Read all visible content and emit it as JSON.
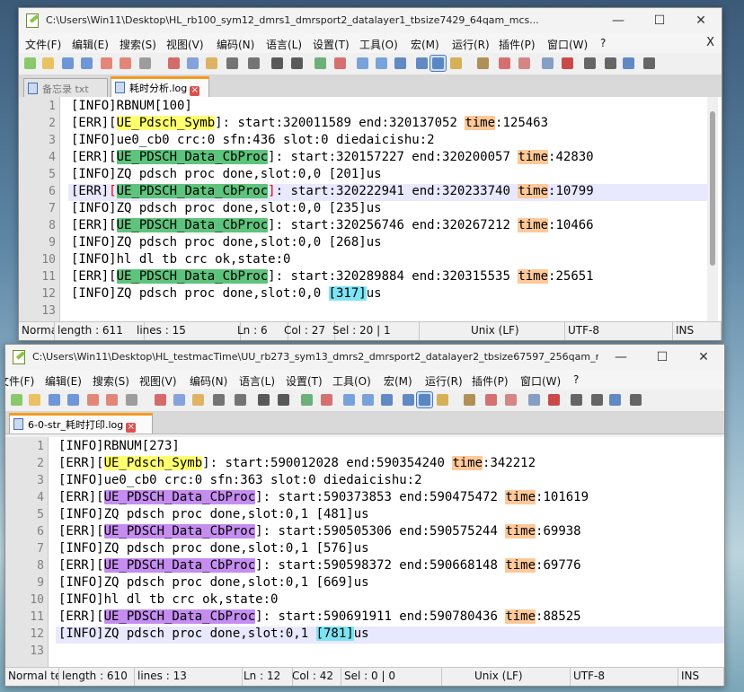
{
  "menu": [
    "文件(F)",
    "编辑(E)",
    "搜索(S)",
    "视图(V)",
    "编码(N)",
    "语言(L)",
    "设置(T)",
    "工具(O)",
    "宏(M)",
    "运行(R)",
    "插件(P)",
    "窗口(W)",
    "?"
  ],
  "window_controls": {
    "minimize": "—",
    "maximize": "☐",
    "close": "✕"
  },
  "menu_close": "X",
  "toolbar_icons": [
    "new-file-icon",
    "open-file-icon",
    "save-icon",
    "save-all-icon",
    "close-icon",
    "close-all-icon",
    "print-icon",
    "cut-icon",
    "copy-icon",
    "paste-icon",
    "undo-icon",
    "redo-icon",
    "find-icon",
    "replace-icon",
    "zoom-in-icon",
    "zoom-out-icon",
    "sync-vertical-icon",
    "sync-horizontal-icon",
    "word-wrap-icon",
    "show-all-chars-icon",
    "indent-guide-icon",
    "udl-icon",
    "doc-map-icon",
    "function-list-icon",
    "folder-workspace-icon",
    "monitor-icon",
    "record-macro-icon",
    "stop-macro-icon",
    "play-macro-icon",
    "run-macro-multiple-icon",
    "save-macro-icon"
  ],
  "windows": [
    {
      "title": "C:\\Users\\Win11\\Desktop\\HL_rb100_sym12_dmrs1_dmrsport2_datalayer1_tbsize7429_64qam_mcs...",
      "tabs": [
        {
          "label": "备忘录 txt",
          "active": false
        },
        {
          "label": "耗时分析.log",
          "active": true
        }
      ],
      "lines": [
        {
          "n": "1",
          "parts": [
            {
              "t": "[INFO]RBNUM[100]"
            }
          ]
        },
        {
          "n": "2",
          "parts": [
            {
              "t": "[ERR]["
            },
            {
              "t": "UE_Pdsch_Symb",
              "c": "yellow"
            },
            {
              "t": "]: start:320011589 end:320137052 "
            },
            {
              "t": "time",
              "c": "orange"
            },
            {
              "t": ":125463"
            }
          ]
        },
        {
          "n": "3",
          "parts": [
            {
              "t": "[INFO]ue0_cb0 crc:0 sfn:436 slot:0 diedaicishu:2"
            }
          ]
        },
        {
          "n": "4",
          "parts": [
            {
              "t": "[ERR]["
            },
            {
              "t": "UE_PDSCH_Data_CbProc",
              "c": "green"
            },
            {
              "t": "]: start:320157227 end:320200057 "
            },
            {
              "t": "time",
              "c": "orange"
            },
            {
              "t": ":42830"
            }
          ]
        },
        {
          "n": "5",
          "parts": [
            {
              "t": "[INFO]ZQ pdsch proc done,slot:0,0 [201]us"
            }
          ]
        },
        {
          "n": "6",
          "current": true,
          "parts": [
            {
              "t": "[ERR]"
            },
            {
              "t": "[",
              "c": "red"
            },
            {
              "t": "UE_PDSCH_Data_CbProc",
              "c": "green"
            },
            {
              "t": "]",
              "c": "red"
            },
            {
              "t": ": start:320222941 end:320233740 "
            },
            {
              "t": "time",
              "c": "orange"
            },
            {
              "t": ":10799"
            }
          ]
        },
        {
          "n": "7",
          "parts": [
            {
              "t": "[INFO]ZQ pdsch proc done,slot:0,0 [235]us"
            }
          ]
        },
        {
          "n": "8",
          "parts": [
            {
              "t": "[ERR]["
            },
            {
              "t": "UE_PDSCH_Data_CbProc",
              "c": "green"
            },
            {
              "t": "]: start:320256746 end:320267212 "
            },
            {
              "t": "time",
              "c": "orange"
            },
            {
              "t": ":10466"
            }
          ]
        },
        {
          "n": "9",
          "parts": [
            {
              "t": "[INFO]ZQ pdsch proc done,slot:0,0 [268]us"
            }
          ]
        },
        {
          "n": "10",
          "parts": [
            {
              "t": "[INFO]hl dl tb crc ok,state:0"
            }
          ]
        },
        {
          "n": "11",
          "parts": [
            {
              "t": "[ERR]["
            },
            {
              "t": "UE_PDSCH_Data_CbProc",
              "c": "green"
            },
            {
              "t": "]: start:320289884 end:320315535 "
            },
            {
              "t": "time",
              "c": "orange"
            },
            {
              "t": ":25651"
            }
          ]
        },
        {
          "n": "12",
          "parts": [
            {
              "t": "[INFO]ZQ pdsch proc done,slot:0,0 "
            },
            {
              "t": "[317]",
              "c": "cyan"
            },
            {
              "t": "us"
            }
          ]
        },
        {
          "n": "13",
          "parts": [
            {
              "t": ""
            }
          ]
        }
      ],
      "status": [
        "Norma",
        "length : 611",
        "lines : 15",
        "Ln : 6",
        "Col : 27",
        "Sel : 20 | 1",
        "Unix (LF)",
        "UTF-8",
        "INS"
      ]
    },
    {
      "title": "C:\\Users\\Win11\\Desktop\\HL_testmacTime\\UU_rb273_sym13_dmrs2_dmrsport2_datalayer2_tbsize67597_256qam_mcs...",
      "tabs": [
        {
          "label": "6-0-str_耗时打印.log",
          "active": true
        }
      ],
      "lines": [
        {
          "n": "1",
          "parts": [
            {
              "t": "[INFO]RBNUM[273]"
            }
          ]
        },
        {
          "n": "2",
          "parts": [
            {
              "t": "[ERR]["
            },
            {
              "t": "UE_Pdsch_Symb",
              "c": "yellow"
            },
            {
              "t": "]: start:590012028 end:590354240 "
            },
            {
              "t": "time",
              "c": "orange"
            },
            {
              "t": ":342212"
            }
          ]
        },
        {
          "n": "3",
          "parts": [
            {
              "t": "[INFO]ue0_cb0 crc:0 sfn:363 slot:0 diedaicishu:2"
            }
          ]
        },
        {
          "n": "4",
          "parts": [
            {
              "t": "[ERR]["
            },
            {
              "t": "UE_PDSCH_Data_CbProc",
              "c": "purple"
            },
            {
              "t": "]: start:590373853 end:590475472 "
            },
            {
              "t": "time",
              "c": "orange"
            },
            {
              "t": ":101619"
            }
          ]
        },
        {
          "n": "5",
          "parts": [
            {
              "t": "[INFO]ZQ pdsch proc done,slot:0,1 [481]us"
            }
          ]
        },
        {
          "n": "6",
          "parts": [
            {
              "t": "[ERR]["
            },
            {
              "t": "UE_PDSCH_Data_CbProc",
              "c": "purple"
            },
            {
              "t": "]: start:590505306 end:590575244 "
            },
            {
              "t": "time",
              "c": "orange"
            },
            {
              "t": ":69938"
            }
          ]
        },
        {
          "n": "7",
          "parts": [
            {
              "t": "[INFO]ZQ pdsch proc done,slot:0,1 [576]us"
            }
          ]
        },
        {
          "n": "8",
          "parts": [
            {
              "t": "[ERR]["
            },
            {
              "t": "UE_PDSCH_Data_CbProc",
              "c": "purple"
            },
            {
              "t": "]: start:590598372 end:590668148 "
            },
            {
              "t": "time",
              "c": "orange"
            },
            {
              "t": ":69776"
            }
          ]
        },
        {
          "n": "9",
          "parts": [
            {
              "t": "[INFO]ZQ pdsch proc done,slot:0,1 [669]us"
            }
          ]
        },
        {
          "n": "10",
          "parts": [
            {
              "t": "[INFO]hl dl tb crc ok,state:0"
            }
          ]
        },
        {
          "n": "11",
          "parts": [
            {
              "t": "[ERR]["
            },
            {
              "t": "UE_PDSCH_Data_CbProc",
              "c": "purple"
            },
            {
              "t": "]: start:590691911 end:590780436 "
            },
            {
              "t": "time",
              "c": "orange"
            },
            {
              "t": ":88525"
            }
          ]
        },
        {
          "n": "12",
          "current": true,
          "parts": [
            {
              "t": "[INFO]ZQ pdsch proc done,slot:0,1 "
            },
            {
              "t": "[781]",
              "c": "cyan"
            },
            {
              "t": "us"
            }
          ]
        },
        {
          "n": "13",
          "parts": [
            {
              "t": ""
            }
          ]
        }
      ],
      "status": [
        "Normal te",
        "length : 610",
        "lines : 13",
        "Ln : 12",
        "Col : 42",
        "Sel : 0 | 0",
        "Unix (LF)",
        "UTF-8",
        "INS"
      ]
    }
  ]
}
